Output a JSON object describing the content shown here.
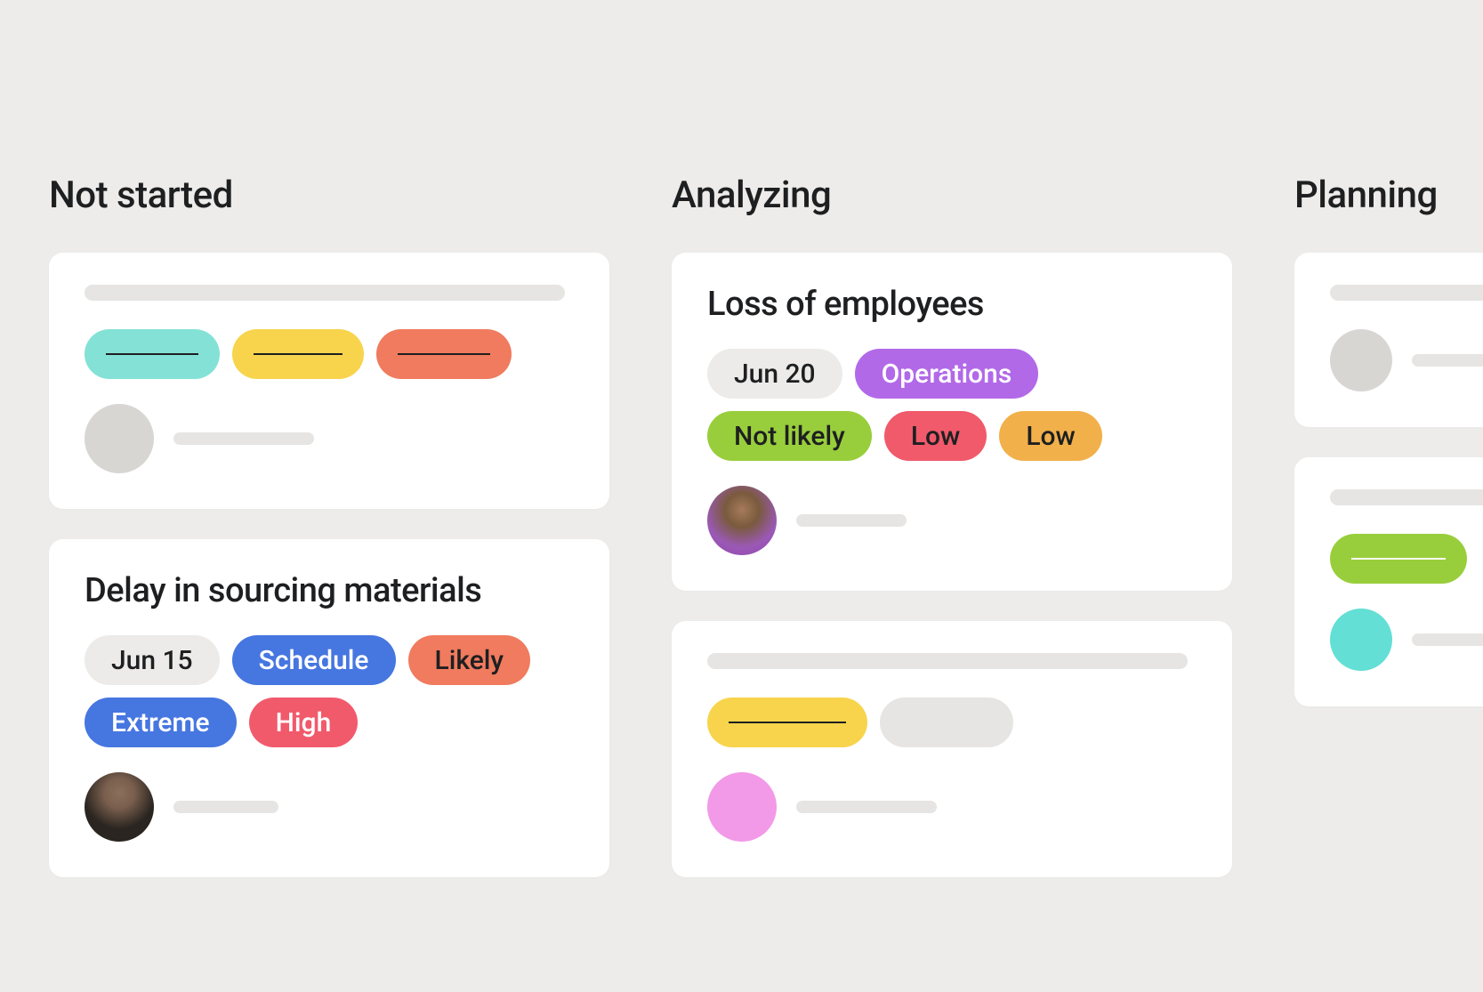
{
  "columns": [
    {
      "title": "Not started",
      "cards": [
        {
          "type": "placeholder"
        },
        {
          "type": "task",
          "title": "Delay in sourcing materials",
          "tags": [
            {
              "label": "Jun 15",
              "color": "gray"
            },
            {
              "label": "Schedule",
              "color": "blue"
            },
            {
              "label": "Likely",
              "color": "orange-dark"
            },
            {
              "label": "Extreme",
              "color": "blue"
            },
            {
              "label": "High",
              "color": "red-dark"
            }
          ],
          "assignee": "avatar-1"
        }
      ]
    },
    {
      "title": "Analyzing",
      "cards": [
        {
          "type": "task",
          "title": "Loss of employees",
          "tags": [
            {
              "label": "Jun 20",
              "color": "gray"
            },
            {
              "label": "Operations",
              "color": "purple"
            },
            {
              "label": "Not likely",
              "color": "green"
            },
            {
              "label": "Low",
              "color": "red-dark"
            },
            {
              "label": "Low",
              "color": "amber"
            }
          ],
          "assignee": "avatar-2"
        },
        {
          "type": "placeholder2"
        }
      ]
    },
    {
      "title": "Planning",
      "cards": [
        {
          "type": "placeholder3"
        },
        {
          "type": "placeholder4"
        }
      ]
    }
  ]
}
